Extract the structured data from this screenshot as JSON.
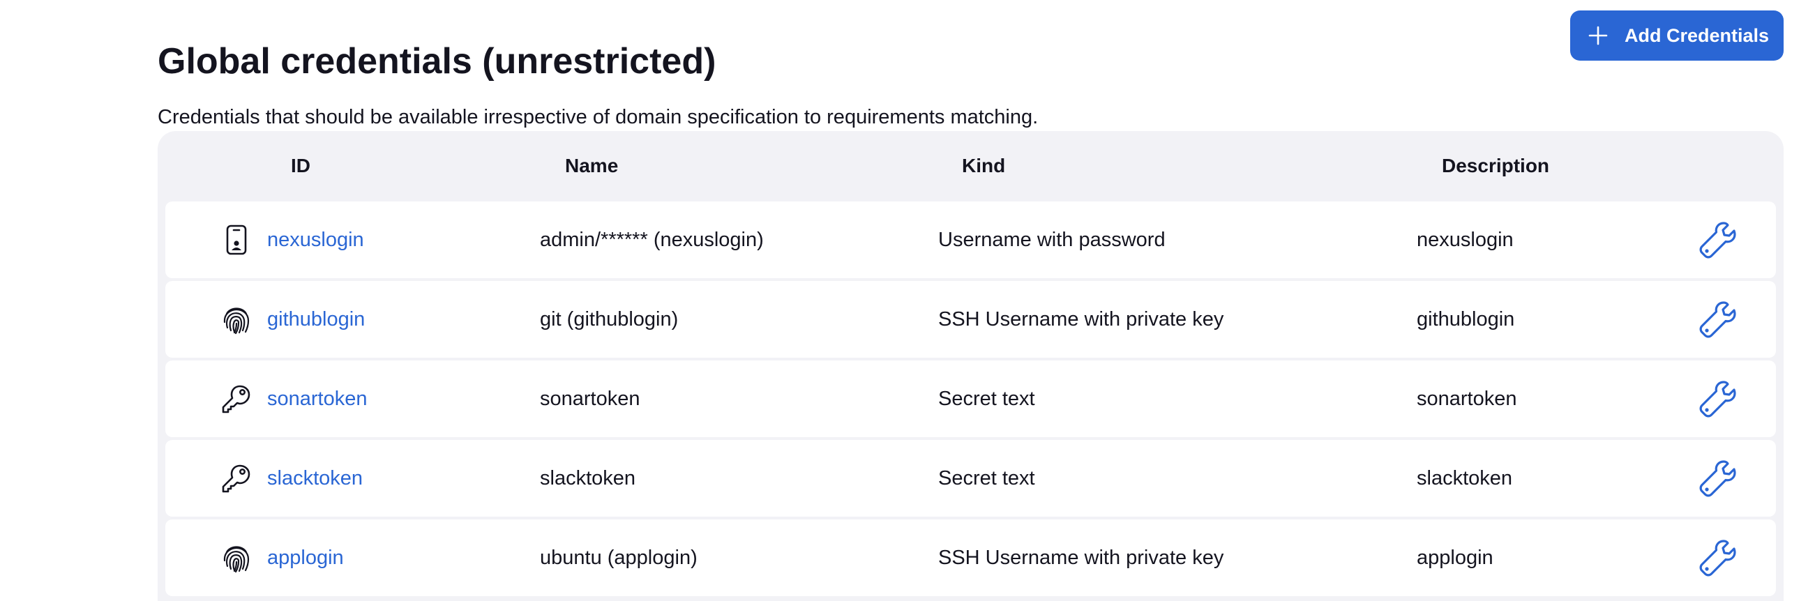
{
  "header": {
    "title": "Global credentials (unrestricted)",
    "add_button_label": "Add Credentials",
    "description": "Credentials that should be available irrespective of domain specification to requirements matching."
  },
  "table": {
    "columns": {
      "id": "ID",
      "name": "Name",
      "kind": "Kind",
      "description": "Description"
    },
    "rows": [
      {
        "icon": "phone-certificate-icon",
        "id": "nexuslogin",
        "name": "admin/****** (nexuslogin)",
        "kind": "Username with password",
        "description": "nexuslogin"
      },
      {
        "icon": "fingerprint-icon",
        "id": "githublogin",
        "name": "git (githublogin)",
        "kind": "SSH Username with private key",
        "description": "githublogin"
      },
      {
        "icon": "key-icon",
        "id": "sonartoken",
        "name": "sonartoken",
        "kind": "Secret text",
        "description": "sonartoken"
      },
      {
        "icon": "key-icon",
        "id": "slacktoken",
        "name": "slacktoken",
        "kind": "Secret text",
        "description": "slacktoken"
      },
      {
        "icon": "fingerprint-icon",
        "id": "applogin",
        "name": "ubuntu (applogin)",
        "kind": "SSH Username with private key",
        "description": "applogin"
      }
    ]
  },
  "colors": {
    "accent": "#2a66d4",
    "panel_background": "#f2f2f6",
    "text": "#14141f"
  }
}
